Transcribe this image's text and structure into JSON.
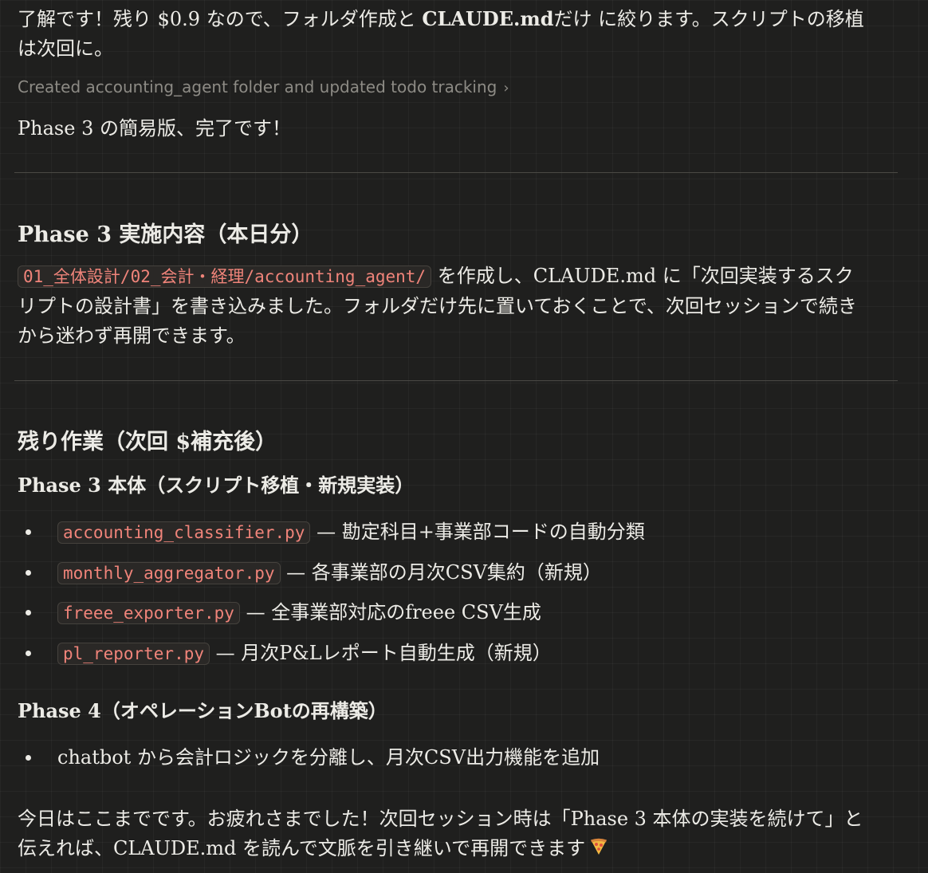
{
  "intro": {
    "pre": "了解です！残り $0.9 なので、フォルダ作成と ",
    "bold": "CLAUDE.md",
    "post": "だけ に絞ります。スクリプトの移植は次回に。"
  },
  "tool_call": {
    "label": "Created accounting_agent folder and updated todo tracking",
    "chevron": "›"
  },
  "done_text": "Phase 3 の簡易版、完了です！",
  "section1": {
    "title": "Phase 3 実施内容（本日分）",
    "code": "01_全体設計/02_会計・経理/accounting_agent/",
    "text": " を作成し、CLAUDE.md に「次回実装するスクリプトの設計書」を書き込みました。フォルダだけ先に置いておくことで、次回セッションで続きから迷わず再開できます。"
  },
  "section2": {
    "title": "残り作業（次回 $補充後）",
    "sub1": "Phase 3 本体（スクリプト移植・新規実装）",
    "items1": [
      {
        "code": "accounting_classifier.py",
        "text": " — 勘定科目+事業部コードの自動分類"
      },
      {
        "code": "monthly_aggregator.py",
        "text": " — 各事業部の月次CSV集約（新規）"
      },
      {
        "code": "freee_exporter.py",
        "text": " — 全事業部対応のfreee CSV生成"
      },
      {
        "code": "pl_reporter.py",
        "text": " — 月次P&Lレポート自動生成（新規）"
      }
    ],
    "sub2": "Phase 4（オペレーションBotの再構築）",
    "items2": [
      {
        "text": "chatbot から会計ロジックを分離し、月次CSV出力機能を追加"
      }
    ]
  },
  "outro": "今日はここまでです。お疲れさまでした！次回セッション時は「Phase 3 本体の実装を続けて」と伝えれば、CLAUDE.md を読んで文脈を引き継いで再開できます",
  "icons": {
    "pizza": "pizza-icon"
  },
  "colors": {
    "background": "#1f1f1e",
    "text": "#ecebe6",
    "code": "#f0847a",
    "muted": "#8d8b85"
  }
}
